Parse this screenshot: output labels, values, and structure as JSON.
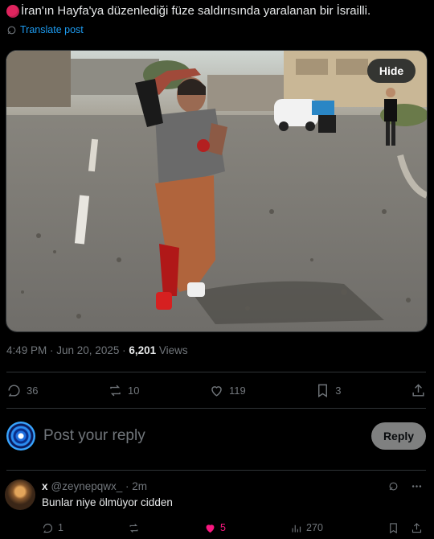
{
  "post": {
    "text": "İran'ın Hayfa'ya düzenlediği füze saldırısında yaralanan bir İsrailli.",
    "translate_label": "Translate post",
    "media_hide_label": "Hide",
    "time": "4:49 PM · Jun 20, 2025 · ",
    "views_count": "6,201",
    "views_label": " Views"
  },
  "actions": {
    "replies": "36",
    "reposts": "10",
    "likes": "119",
    "bookmarks": "3"
  },
  "reply_box": {
    "placeholder": "Post your reply",
    "button_label": "Reply"
  },
  "comment": {
    "name": "x",
    "handle": "@zeynepqwx_ · 2m",
    "text": "Bunlar niye ölmüyor cidden",
    "replies": "1",
    "likes": "5",
    "views": "270"
  },
  "colors": {
    "accent": "#1d9bf0",
    "like": "#f91880",
    "muted": "#71767b",
    "background": "#000000"
  }
}
